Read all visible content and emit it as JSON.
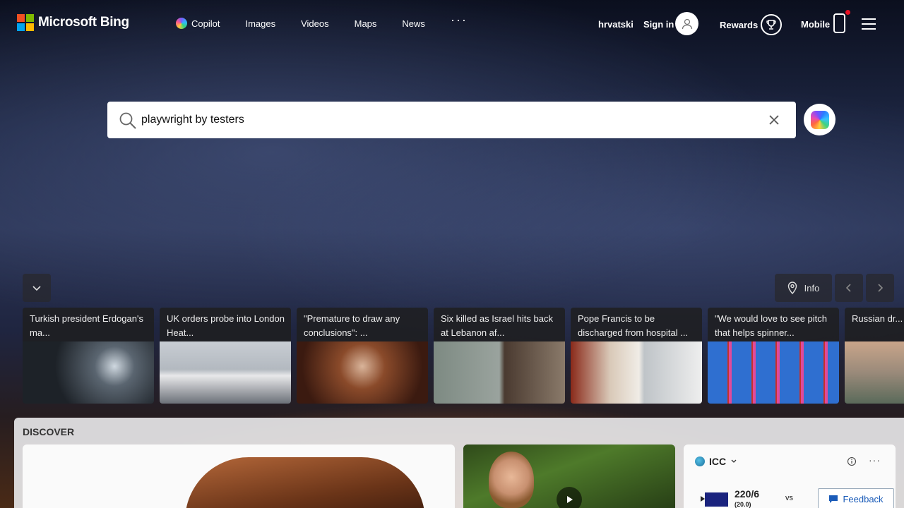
{
  "brand": {
    "name": "Microsoft Bing",
    "logo_colors": [
      "#f25022",
      "#7fba00",
      "#00a4ef",
      "#ffb900"
    ]
  },
  "nav": {
    "items": [
      {
        "label": "Copilot",
        "icon": "copilot-icon"
      },
      {
        "label": "Images"
      },
      {
        "label": "Videos"
      },
      {
        "label": "Maps"
      },
      {
        "label": "News"
      },
      {
        "label": "···"
      }
    ]
  },
  "account": {
    "language": "hrvatski",
    "signin_label": "Sign in",
    "rewards_label": "Rewards",
    "mobile_label": "Mobile",
    "mobile_notification_color": "#e81123"
  },
  "search": {
    "query": "playwright by testers"
  },
  "controls": {
    "info_label": "Info"
  },
  "news": [
    {
      "title": "Turkish president Erdogan's ma..."
    },
    {
      "title": "UK orders probe into London Heat..."
    },
    {
      "title": "\"Premature to draw any conclusions\": ..."
    },
    {
      "title": "Six killed as Israel hits back at Lebanon af..."
    },
    {
      "title": "Pope Francis to be discharged from hospital ..."
    },
    {
      "title": "\"We would love to see pitch that helps spinner..."
    },
    {
      "title": "Russian dr... kills three a..."
    }
  ],
  "discover": {
    "title": "DISCOVER",
    "scoreboard": {
      "league": "ICC",
      "score": "220/6",
      "overs": "(20.0)",
      "vs": "vs"
    }
  },
  "feedback_label": "Feedback"
}
